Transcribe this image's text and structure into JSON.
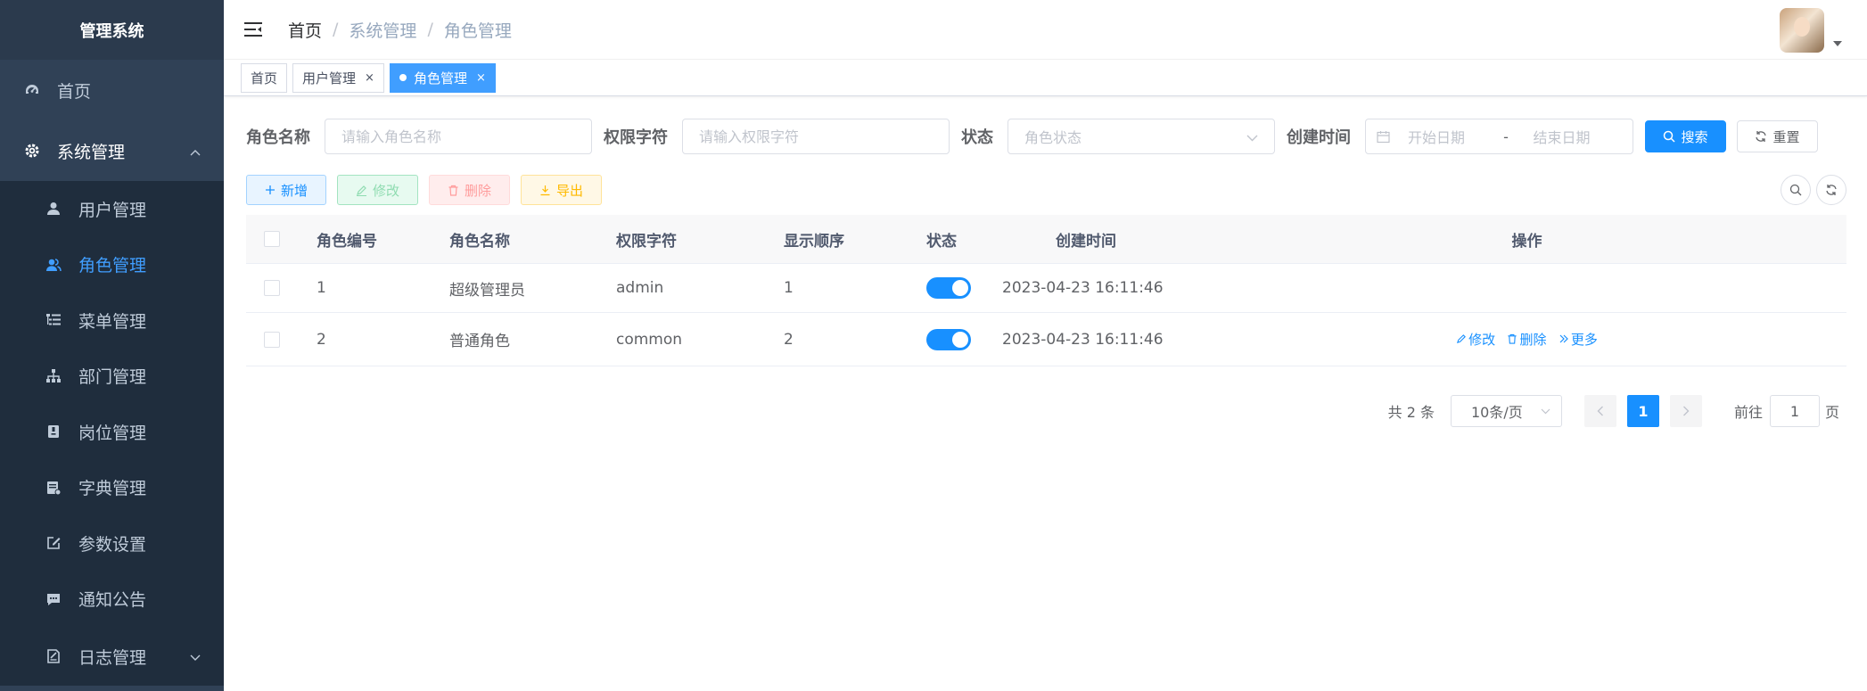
{
  "sidebar": {
    "title": "管理系统",
    "items": [
      {
        "label": "首页",
        "icon": "dashboard-icon"
      },
      {
        "label": "系统管理",
        "icon": "gear-icon",
        "expanded": true
      },
      {
        "label": "用户管理",
        "icon": "user-icon"
      },
      {
        "label": "角色管理",
        "icon": "peoples-icon",
        "active": true
      },
      {
        "label": "菜单管理",
        "icon": "tree-table-icon"
      },
      {
        "label": "部门管理",
        "icon": "tree-icon"
      },
      {
        "label": "岗位管理",
        "icon": "post-icon"
      },
      {
        "label": "字典管理",
        "icon": "dict-icon"
      },
      {
        "label": "参数设置",
        "icon": "edit-icon"
      },
      {
        "label": "通知公告",
        "icon": "message-icon"
      },
      {
        "label": "日志管理",
        "icon": "log-icon"
      }
    ]
  },
  "navbar": {
    "breadcrumb": [
      "首页",
      "系统管理",
      "角色管理"
    ]
  },
  "tags": [
    {
      "label": "首页",
      "active": false
    },
    {
      "label": "用户管理",
      "active": false,
      "close": "×"
    },
    {
      "label": "角色管理",
      "active": true,
      "close": "×"
    }
  ],
  "search": {
    "role_name_label": "角色名称",
    "role_name_placeholder": "请输入角色名称",
    "perm_label": "权限字符",
    "perm_placeholder": "请输入权限字符",
    "status_label": "状态",
    "status_placeholder": "角色状态",
    "time_label": "创建时间",
    "start_placeholder": "开始日期",
    "range_sep": "-",
    "end_placeholder": "结束日期",
    "search_btn": "搜索",
    "reset_btn": "重置"
  },
  "toolbar": {
    "add": "新增",
    "edit": "修改",
    "delete": "删除",
    "export": "导出"
  },
  "table": {
    "headers": [
      "角色编号",
      "角色名称",
      "权限字符",
      "显示顺序",
      "状态",
      "创建时间",
      "操作"
    ],
    "rows": [
      {
        "id": "1",
        "name": "超级管理员",
        "perm": "admin",
        "sort": "1",
        "status": true,
        "time": "2023-04-23 16:11:46",
        "ops": []
      },
      {
        "id": "2",
        "name": "普通角色",
        "perm": "common",
        "sort": "2",
        "status": true,
        "time": "2023-04-23 16:11:46",
        "ops": [
          "修改",
          "删除",
          "更多"
        ]
      }
    ]
  },
  "pagination": {
    "total": "共 2 条",
    "page_size": "10条/页",
    "current": "1",
    "goto_label": "前往",
    "goto_value": "1",
    "page_suffix": "页"
  },
  "colors": {
    "sidebar_bg": "#304156",
    "primary": "#1890ff"
  }
}
